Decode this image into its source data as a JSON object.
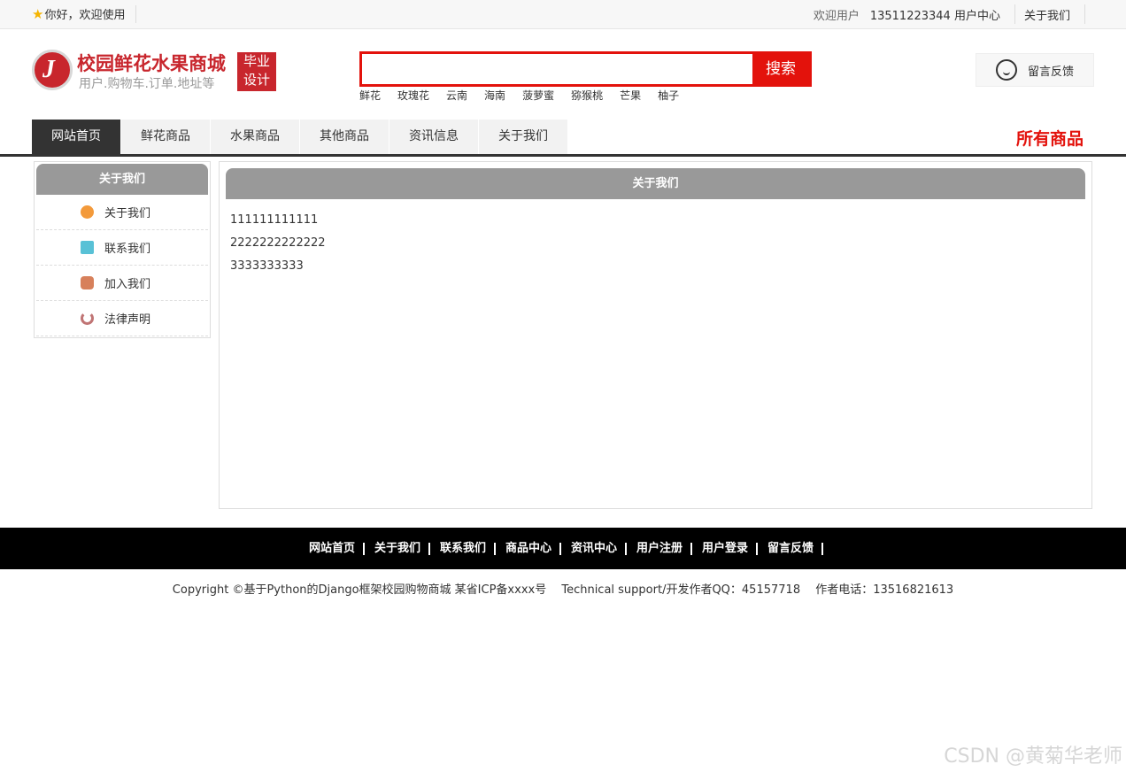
{
  "topbar": {
    "welcome": "你好，欢迎使用",
    "greet": "欢迎用户",
    "phone": "13511223344",
    "user_center": "用户中心",
    "about": "关于我们"
  },
  "logo": {
    "letter": "J",
    "title": "校园鲜花水果商城",
    "subtitle": "用户.购物车.订单.地址等",
    "badge_line1": "毕业",
    "badge_line2": "设计"
  },
  "search": {
    "placeholder": "",
    "button": "搜索",
    "hotwords": [
      "鲜花",
      "玫瑰花",
      "云南",
      "海南",
      "菠萝蜜",
      "猕猴桃",
      "芒果",
      "柚子"
    ]
  },
  "feedback": {
    "label": "留言反馈",
    "icon": "headset-icon"
  },
  "nav": {
    "items": [
      "网站首页",
      "鲜花商品",
      "水果商品",
      "其他商品",
      "资讯信息",
      "关于我们"
    ],
    "all_goods": "所有商品"
  },
  "sidebar": {
    "title": "关于我们",
    "items": [
      {
        "label": "关于我们",
        "icon": "info-icon"
      },
      {
        "label": "联系我们",
        "icon": "clipboard-icon"
      },
      {
        "label": "加入我们",
        "icon": "lock-icon"
      },
      {
        "label": "法律声明",
        "icon": "power-icon"
      }
    ]
  },
  "main": {
    "title": "关于我们",
    "lines": [
      "111111111111",
      "2222222222222",
      "3333333333"
    ]
  },
  "footer": {
    "links": [
      "网站首页",
      "关于我们",
      "联系我们",
      "商品中心",
      "资讯中心",
      "用户注册",
      "用户登录",
      "留言反馈"
    ],
    "copyright": "Copyright ©基于Python的Django框架校园购物商城 某省ICP备xxxx号　 Technical support/开发作者QQ：45157718　  作者电话：13516821613"
  },
  "watermark": "CSDN @黄菊华老师"
}
